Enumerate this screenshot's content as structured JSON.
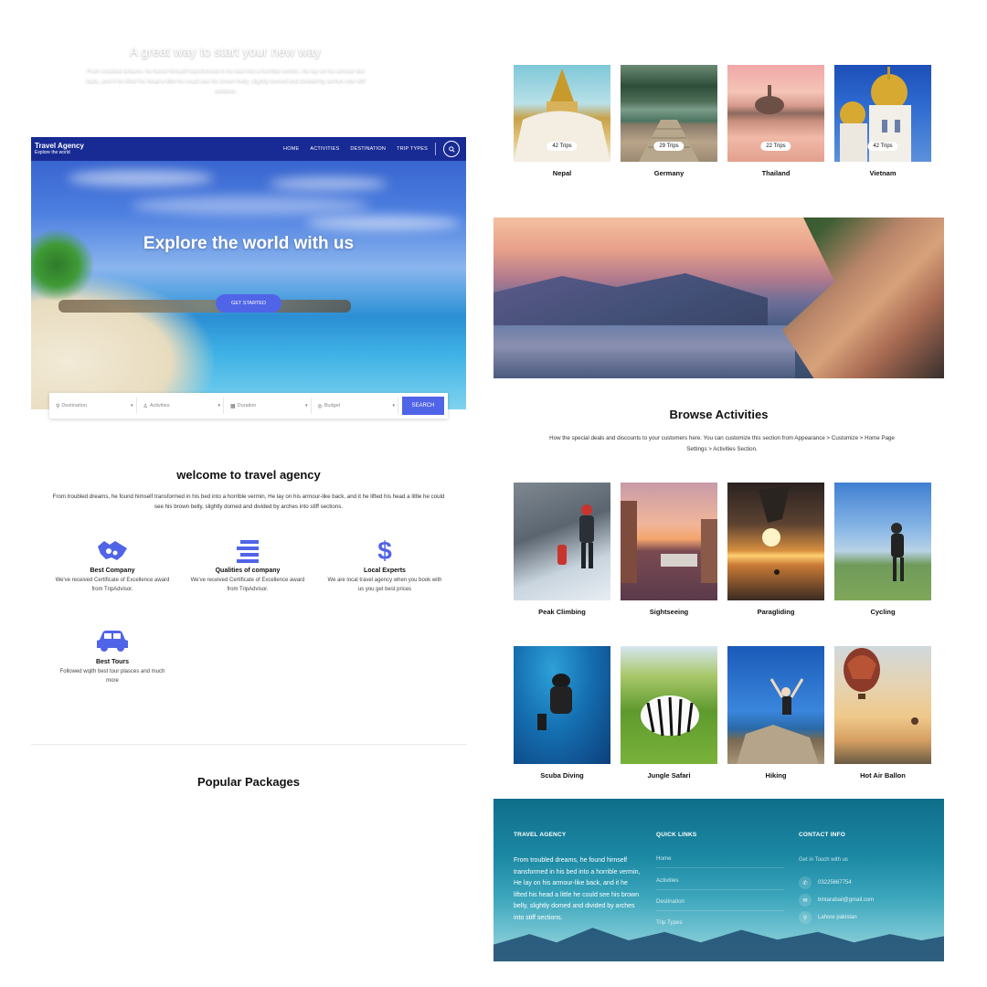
{
  "site": {
    "brand": {
      "title": "Travel Agency",
      "subtitle": "Explore the world"
    },
    "nav": [
      "HOME",
      "ACTIVITIES",
      "DESTINATION",
      "TRIP TYPES"
    ],
    "hero": {
      "title": "Explore the world with us",
      "cta": "GET STARTED"
    },
    "filters": {
      "destination": "Destination",
      "activities": "Activities",
      "duration": "Duration",
      "budget": "Budget",
      "search": "SEARCH"
    },
    "welcome": {
      "title": "welcome to travel agency",
      "text": "From troubled dreams, he found himself transformed in his bed into a horrible vermin, He lay on his armour-like back, and it he lifted his head a little he could see his brown belly, slightly domed and divided by arches into stiff sections."
    },
    "features": [
      {
        "icon": "handshake-icon",
        "title": "Best Company",
        "desc": "We've received Certificate of Excellence award from TripAdvisor."
      },
      {
        "icon": "list-icon",
        "title": "Qualities of company",
        "desc": "We've received Certificate of Excellence award from TripAdvisor."
      },
      {
        "icon": "dollar-icon",
        "title": "Local Experts",
        "desc": "We are local travel agency when you book with us you get best prices"
      },
      {
        "icon": "car-icon",
        "title": "Best Tours",
        "desc": "Followed wqith best tour plasces and much more"
      }
    ],
    "popular_title": "Popular Packages"
  },
  "destinations": [
    {
      "name": "Nepal",
      "trips": "42 Trips"
    },
    {
      "name": "Germany",
      "trips": "29 Trips"
    },
    {
      "name": "Thailand",
      "trips": "22 Trips"
    },
    {
      "name": "Vietnam",
      "trips": "42 Trips"
    }
  ],
  "promo": {
    "title": "A great way to start your new way",
    "text": "From troubled dreams, he found himself transformed in his bed into a horrible vermin, He lay on his armour-like back, and it he lifted his head a little he could see his brown belly, slightly domed and divided by arches into stiff sections."
  },
  "browse": {
    "title": "Browse Activities",
    "text": "How the special deals and discounts to your customers here. You can customize this section from Appearance > Customize > Home Page Settings > Activities Section."
  },
  "activities": [
    "Peak Climbing",
    "Sightseeing",
    "Paragliding",
    "Cycling",
    "Scuba Diving",
    "Jungle Safari",
    "Hiking",
    "Hot Air Ballon"
  ],
  "footer": {
    "about_heading": "TRAVEL AGENCY",
    "about_text": "From troubled dreams, he found himself transformed in his bed into a horrible vermin, He lay on his armour-like back, and it he lifted his head a little he could see his brown belly, slightly domed and divided by arches into stiff sections.",
    "links_heading": "QUICK LINKS",
    "links": [
      "Home",
      "Activities",
      "Destination",
      "Trip Types"
    ],
    "contact_heading": "CONTACT INFO",
    "contact_sub": "Get in Touch with us",
    "phone": "03225667754",
    "email": "bintarabail@gmail.com",
    "address": "Lahore pakistan"
  },
  "colors": {
    "accent": "#5064e8",
    "nav_bg": "#14238c",
    "footer": "#1b88a3"
  }
}
